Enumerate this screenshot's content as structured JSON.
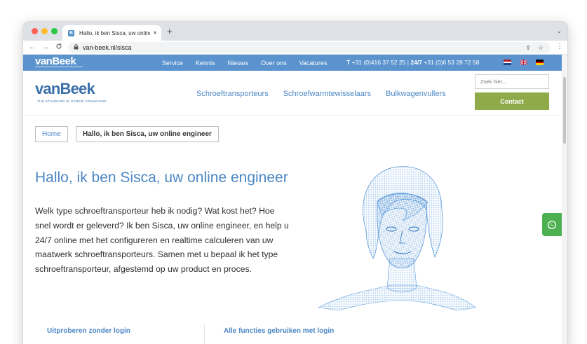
{
  "browser": {
    "tab_title": "Hallo, ik ben Sisca, uw online e",
    "favicon_letter": "B",
    "tab_close": "×",
    "new_tab": "+",
    "url": "van-beek.nl/sisca",
    "back": "←",
    "forward": "→",
    "reload": "C",
    "lock": "🔒",
    "share_icon": "⇪",
    "bookmark_icon": "☆",
    "menu_icon": "⋮",
    "tab_menu": "⌄"
  },
  "topbar": {
    "logo": "vanBeek",
    "nav": [
      "Service",
      "Kennis",
      "Nieuws",
      "Over ons",
      "Vacatures"
    ],
    "phone_label_t": "T",
    "phone_t": "+31 (0)416 37 52 25",
    "separator": "|",
    "phone_label_247": "24/7",
    "phone_247": "+31 (0)6 53 28 72 58",
    "flags": [
      "nl-flag-icon",
      "uk-flag-icon",
      "de-flag-icon"
    ]
  },
  "header": {
    "logo": "vanBeek",
    "logo_tagline": "THE STANDARD IN SCREW CONVEYING",
    "nav": [
      "Schroeftransporteurs",
      "Schroefwarmtewisselaars",
      "Bulkwagenvullers"
    ],
    "search_placeholder": "Zoek hier...",
    "contact_label": "Contact"
  },
  "breadcrumb": {
    "home": "Home",
    "current": "Hallo, ik ben Sisca, uw online engineer"
  },
  "main": {
    "title": "Hallo, ik ben Sisca, uw online engineer",
    "intro": "Welk type schroeftransporteur heb ik nodig? Wat kost het? Hoe snel wordt er geleverd? Ik ben Sisca, uw online engineer, en help u 24/7 online met het configureren en realtime calculeren van uw maatwerk schroeftransporteurs. Samen met u bepaal ik het type schroeftransporteur, afgestemd op uw product en proces."
  },
  "bottom": {
    "link_1": "Uitproberen zonder login",
    "link_2": "Alle functies gebruiken met login"
  },
  "colors": {
    "brand_blue": "#5b93ce",
    "link_blue": "#4b87c4",
    "contact_green": "#8eaa49",
    "whatsapp_green": "#4caf50"
  },
  "icons": {
    "whatsapp": "whatsapp-icon",
    "avatar": "sisca-wireframe-face"
  }
}
